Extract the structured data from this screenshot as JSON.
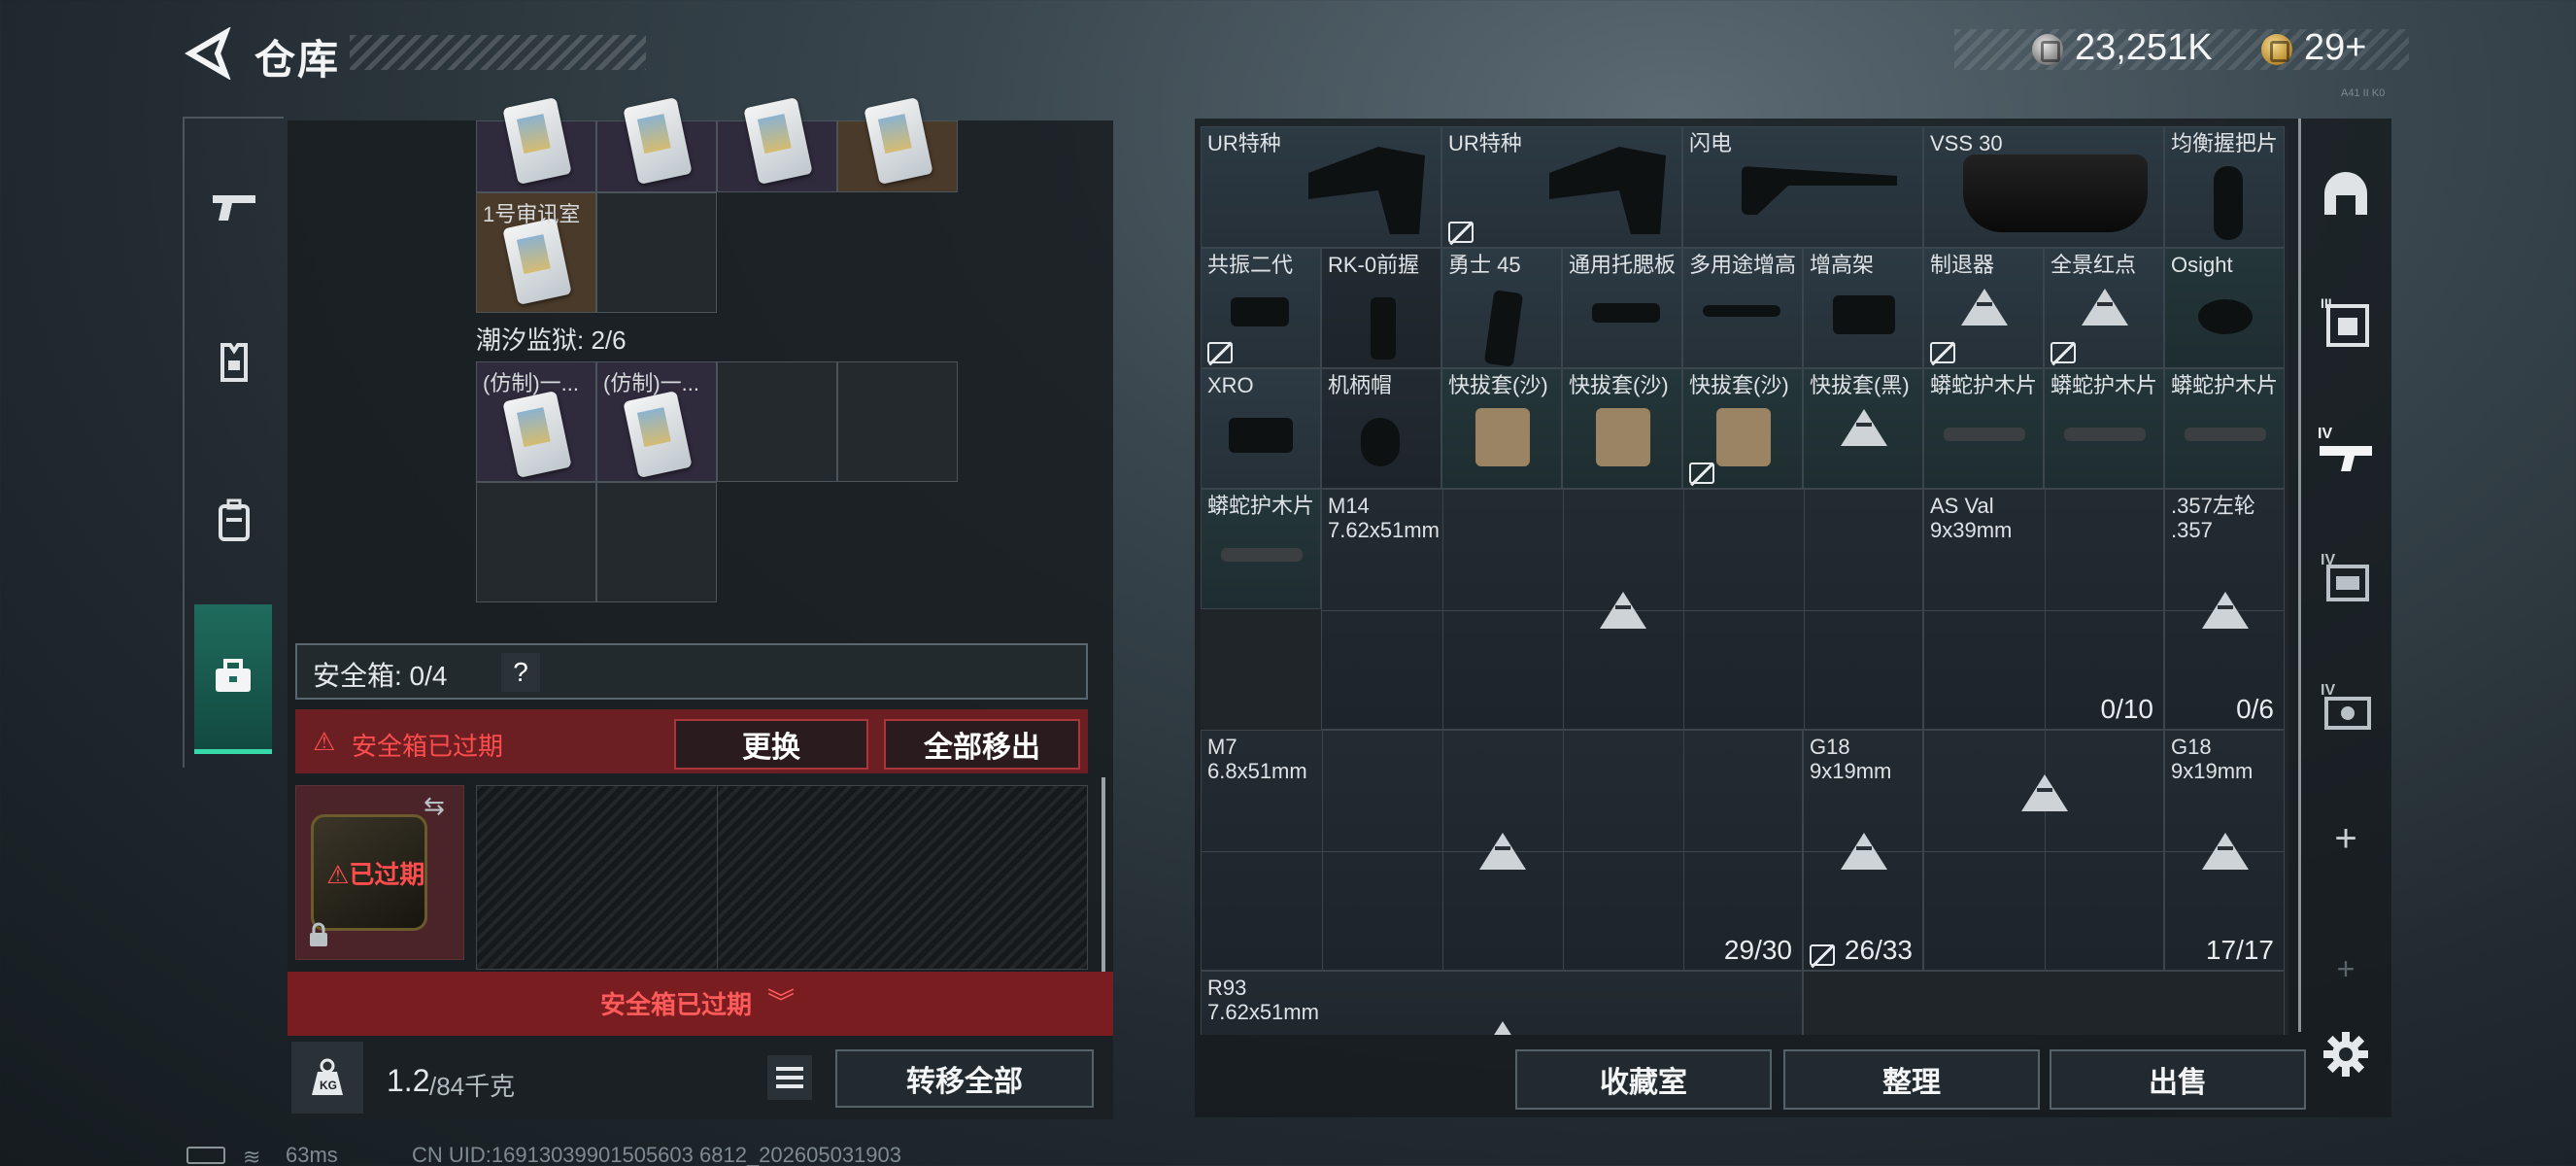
{
  "header": {
    "title": "仓库",
    "silver_amount": "23,251K",
    "gold_amount": "29+",
    "version_tag": "A41 II K0"
  },
  "colors": {
    "accent_green": "#38d9a9",
    "expired_red": "#ff4d4d"
  },
  "left_sidebar": {
    "items": [
      {
        "icon": "gun-icon"
      },
      {
        "icon": "armor-icon"
      },
      {
        "icon": "backpack-icon"
      },
      {
        "icon": "toolbox-icon",
        "active": true
      }
    ]
  },
  "container": {
    "room_label": "1号审讯室",
    "section_label": "潮汐监狱: 2/6",
    "item_1": "(仿制)一...",
    "item_2": "(仿制)一..."
  },
  "safebox": {
    "label": "安全箱: 0/4",
    "help": "?",
    "expired_text": "安全箱已过期",
    "replace_button": "更换",
    "remove_all_button": "全部移出",
    "item_status": "已过期",
    "footer_text": "安全箱已过期"
  },
  "weight": {
    "current": "1.2",
    "max": "/84千克"
  },
  "transfer_all_button": "转移全部",
  "stash": {
    "items": [
      {
        "name": "UR特种"
      },
      {
        "name": "UR特种"
      },
      {
        "name": "闪电"
      },
      {
        "name": "VSS 30"
      },
      {
        "name": "均衡握把片"
      },
      {
        "name": "共振二代"
      },
      {
        "name": "RK-0前握"
      },
      {
        "name": "勇士 45"
      },
      {
        "name": "通用托腮板"
      },
      {
        "name": "多用途增高"
      },
      {
        "name": "增高架"
      },
      {
        "name": "制退器"
      },
      {
        "name": "全景红点"
      },
      {
        "name": "Osight"
      },
      {
        "name": "XRO"
      },
      {
        "name": "机柄帽"
      },
      {
        "name": "快拔套(沙)"
      },
      {
        "name": "快拔套(沙)"
      },
      {
        "name": "快拔套(沙)"
      },
      {
        "name": "快拔套(黑)"
      },
      {
        "name": "蟒蛇护木片"
      },
      {
        "name": "蟒蛇护木片"
      },
      {
        "name": "蟒蛇护木片"
      },
      {
        "name": "蟒蛇护木片"
      },
      {
        "name": "M14",
        "sub": "7.62x51mm"
      },
      {
        "name": "AS Val",
        "sub": "9x39mm",
        "count": "0/10"
      },
      {
        "name": ".357左轮",
        "sub": ".357",
        "count": "0/6"
      },
      {
        "name": "M7",
        "sub": "6.8x51mm",
        "count": "29/30"
      },
      {
        "name": "G18",
        "sub": "9x19mm",
        "count": "26/33"
      },
      {
        "name": "G18",
        "sub": "9x19mm",
        "count": "17/17"
      },
      {
        "name": "R93",
        "sub": "7.62x51mm"
      }
    ]
  },
  "buttons": {
    "collection": "收藏室",
    "sort": "整理",
    "sell": "出售"
  },
  "right_sidebar": {
    "items": [
      {
        "icon": "helmet-icon"
      },
      {
        "icon": "level-III-gear-icon"
      },
      {
        "icon": "level-IV-weapon-icon"
      },
      {
        "icon": "level-IV-card-icon"
      },
      {
        "icon": "level-IV-money-icon"
      }
    ],
    "add_label": "+",
    "add_label_2": "+"
  },
  "status": {
    "ping": "63ms",
    "uid": "CN UID:16913039901505603 6812_202605031903"
  }
}
